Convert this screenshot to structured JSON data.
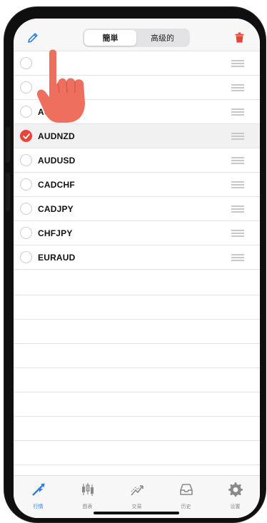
{
  "header": {
    "segments": [
      "簡単",
      "高级的"
    ],
    "active_segment": 0,
    "edit_icon": "pencil-icon",
    "delete_icon": "trash-icon",
    "accent_color": "#e8443a",
    "link_color": "#2f7de1"
  },
  "symbols": [
    {
      "name": "",
      "checked": false
    },
    {
      "name": "",
      "checked": false
    },
    {
      "name": "AUDJPY",
      "checked": false
    },
    {
      "name": "AUDNZD",
      "checked": true
    },
    {
      "name": "AUDUSD",
      "checked": false
    },
    {
      "name": "CADCHF",
      "checked": false
    },
    {
      "name": "CADJPY",
      "checked": false
    },
    {
      "name": "CHFJPY",
      "checked": false
    },
    {
      "name": "EURAUD",
      "checked": false
    }
  ],
  "tabs": [
    {
      "label": "行情",
      "icon": "quotes-icon",
      "active": true
    },
    {
      "label": "图表",
      "icon": "chart-icon",
      "active": false
    },
    {
      "label": "交易",
      "icon": "trade-icon",
      "active": false
    },
    {
      "label": "历史",
      "icon": "history-icon",
      "active": false
    },
    {
      "label": "设置",
      "icon": "settings-icon",
      "active": false
    }
  ]
}
